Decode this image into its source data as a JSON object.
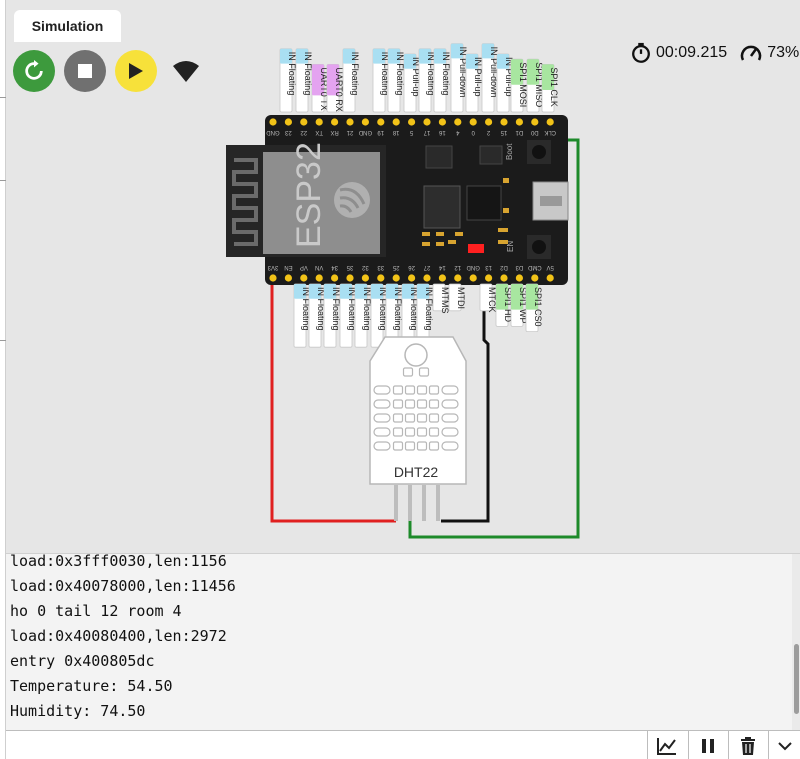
{
  "tab": {
    "label": "Simulation"
  },
  "controls": {
    "restart_color": "#3d9a3d",
    "stop_color": "#707070",
    "play_color": "#f7e13a"
  },
  "status": {
    "timer": "00:09.215",
    "speed": "73%"
  },
  "board": {
    "chip_label": "ESP32",
    "top_pins": [
      "CLK",
      "D0",
      "D1",
      "15",
      "2",
      "0",
      "4",
      "16",
      "17",
      "5",
      "18",
      "19",
      "GND",
      "21",
      "RX",
      "TX",
      "22",
      "23",
      "GND"
    ],
    "bottom_pins": [
      "5V",
      "CMD",
      "D3",
      "D2",
      "13",
      "GND",
      "12",
      "14",
      "27",
      "26",
      "25",
      "33",
      "32",
      "35",
      "34",
      "VN",
      "VP",
      "EN",
      "3V3"
    ],
    "top_labels": [
      {
        "text": "IN Floating"
      },
      {
        "text": "IN Floating"
      },
      {
        "text": "UART0 TX"
      },
      {
        "text": "UART0 RX"
      },
      {
        "text": "IN Floating"
      },
      {
        "text": "IN Floating"
      },
      {
        "text": "IN Floating"
      },
      {
        "text": "IN Pull-up"
      },
      {
        "text": "IN Floating"
      },
      {
        "text": "IN Floating"
      },
      {
        "text": "IN Pull-down"
      },
      {
        "text": "IN Pull-up"
      },
      {
        "text": "IN Pull-down"
      },
      {
        "text": "IN Pull-up"
      },
      {
        "text": "SPI1 MOSI"
      },
      {
        "text": "SPI1 MISO"
      },
      {
        "text": "SPI1 CLK"
      }
    ],
    "bottom_labels": [
      {
        "text": "IN Floating"
      },
      {
        "text": "IN Floating"
      },
      {
        "text": "IN Floating"
      },
      {
        "text": "IN Floating"
      },
      {
        "text": "IN Floating"
      },
      {
        "text": "IN Floating"
      },
      {
        "text": "IN Floating"
      },
      {
        "text": "IN Floating"
      },
      {
        "text": "IN Floating"
      },
      {
        "text": "MTMS"
      },
      {
        "text": "MTDI"
      },
      {
        "text": "MTCK"
      },
      {
        "text": "SPI1 HD"
      },
      {
        "text": "SPI1 WP"
      },
      {
        "text": "SPI1 CS0"
      }
    ],
    "boot_label": "Boot",
    "en_label": "EN"
  },
  "sensor": {
    "label": "DHT22"
  },
  "console": {
    "lines": [
      "load:0x3fff0030,len:1156",
      "load:0x40078000,len:11456",
      "ho 0 tail 12 room 4",
      "load:0x40080400,len:2972",
      "entry 0x400805dc",
      "Temperature: 54.50",
      "Humidity: 74.50"
    ],
    "input_value": "",
    "input_placeholder": ""
  },
  "colors": {
    "wire_red": "#e02020",
    "wire_black": "#111111",
    "wire_green": "#1d8a2a",
    "board": "#1b1b1b",
    "pin_label_blue": "#a9dff2",
    "pin_label_purple": "#e4a3f0",
    "pin_label_green": "#a8e6a0"
  }
}
